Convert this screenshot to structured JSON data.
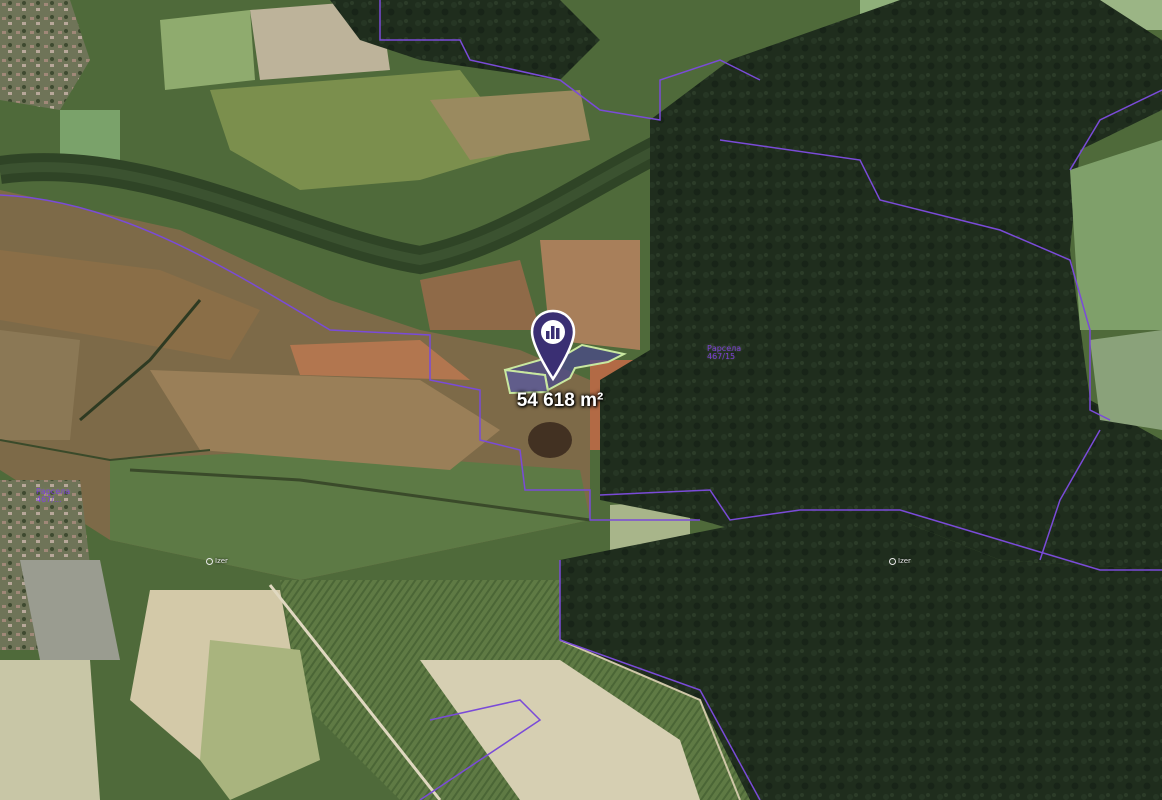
{
  "map": {
    "area_label": "54 618 m²",
    "pin_icon": "building-chart-icon",
    "parcel_labels": [
      {
        "line1": "Рарсела",
        "line2": "467/15"
      },
      {
        "line1": "Рарсела",
        "line2": "467/..."
      }
    ],
    "place_labels": [
      "Izer",
      "Izer"
    ],
    "colors": {
      "pin": "#3a2f73",
      "parcel_outline": "#7a4bd8",
      "selected_fill": "#4a4a8c",
      "selected_outline": "#c9e8a0"
    }
  }
}
